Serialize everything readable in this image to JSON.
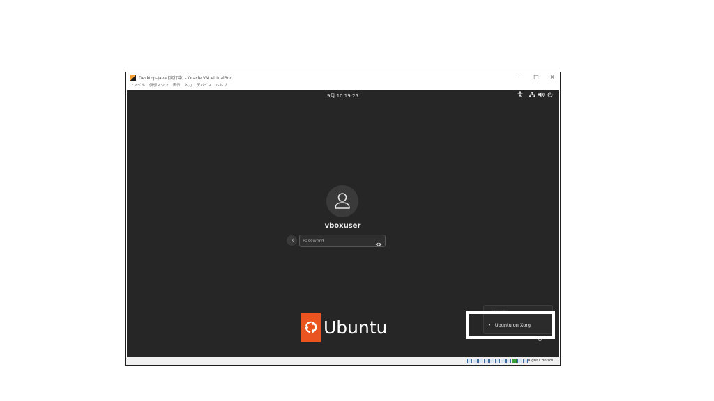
{
  "window": {
    "title": "Desktop-Java [実行中] - Oracle VM VirtualBox",
    "controls": [
      "−",
      "□",
      "×"
    ]
  },
  "menubar": {
    "items": [
      "ファイル",
      "仮想マシン",
      "表示",
      "入力",
      "デバイス",
      "ヘルプ"
    ]
  },
  "gnome": {
    "clock": "9月 10 19:25",
    "tray_icons": [
      "accessibility-icon",
      "network-icon",
      "volume-icon",
      "power-icon"
    ]
  },
  "login": {
    "username": "vboxuser",
    "password_placeholder": "Password",
    "password_value": "",
    "back_symbol": "〈"
  },
  "branding": {
    "wordmark": "Ubuntu",
    "logo_color": "#E95420"
  },
  "session_menu": {
    "hidden_item": "Ubuntu",
    "selected_item": "Ubuntu on Xorg",
    "bullet": "•"
  },
  "statusbar": {
    "host_key": "Right Control"
  },
  "colors": {
    "screen_bg": "#262626",
    "accent": "#E95420",
    "highlight": "#FFFFFF"
  }
}
